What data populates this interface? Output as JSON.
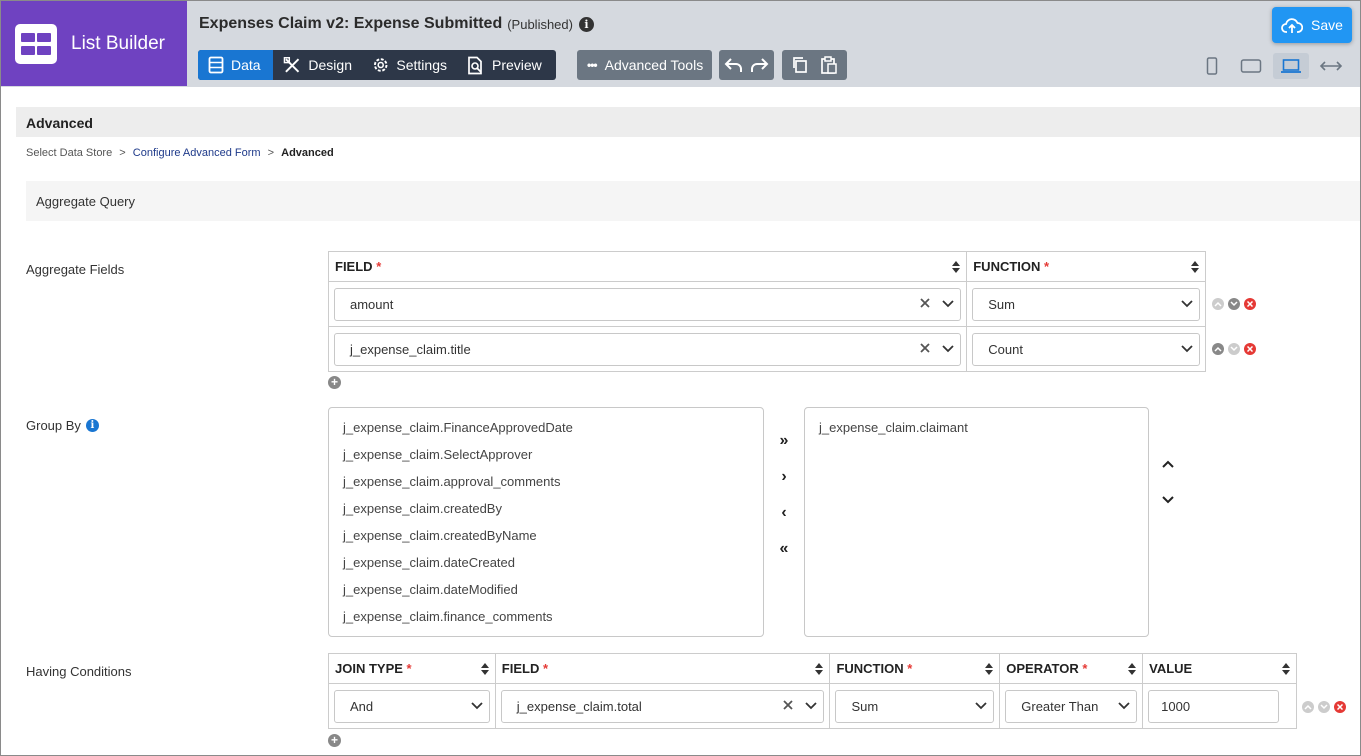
{
  "app": {
    "name": "List Builder"
  },
  "header": {
    "title": "Expenses Claim v2: Expense Submitted",
    "status": "(Published)",
    "info_glyph": "i"
  },
  "tabs": [
    {
      "label": "Data",
      "icon": "data-table-icon",
      "active": true
    },
    {
      "label": "Design",
      "icon": "design-tools-icon",
      "active": false
    },
    {
      "label": "Settings",
      "icon": "gear-icon",
      "active": false
    },
    {
      "label": "Preview",
      "icon": "preview-doc-icon",
      "active": false
    }
  ],
  "toolbar": {
    "advanced_tools_label": "Advanced Tools",
    "save_label": "Save"
  },
  "devices": [
    "mobile-icon",
    "tablet-icon",
    "laptop-icon",
    "fullwidth-icon"
  ],
  "section": {
    "title": "Advanced"
  },
  "breadcrumb": {
    "step1": "Select Data Store",
    "sep": ">",
    "step2": "Configure Advanced Form",
    "step3": "Advanced"
  },
  "panel": {
    "title": "Aggregate Query"
  },
  "aggregate": {
    "label": "Aggregate Fields",
    "headers": {
      "field": "FIELD",
      "function": "FUNCTION",
      "required": "*"
    },
    "rows": [
      {
        "field": "amount",
        "function": "Sum"
      },
      {
        "field": "j_expense_claim.title",
        "function": "Count"
      }
    ]
  },
  "group_by": {
    "label": "Group By",
    "available": [
      "j_expense_claim.FinanceApprovedDate",
      "j_expense_claim.SelectApprover",
      "j_expense_claim.approval_comments",
      "j_expense_claim.createdBy",
      "j_expense_claim.createdByName",
      "j_expense_claim.dateCreated",
      "j_expense_claim.dateModified",
      "j_expense_claim.finance_comments"
    ],
    "selected": [
      "j_expense_claim.claimant"
    ],
    "buttons": {
      "move_all_right": "»",
      "move_right": "›",
      "move_left": "‹",
      "move_all_left": "«"
    }
  },
  "having": {
    "label": "Having Conditions",
    "headers": {
      "join_type": "JOIN TYPE",
      "field": "FIELD",
      "function": "FUNCTION",
      "operator": "OPERATOR",
      "value": "VALUE",
      "required": "*"
    },
    "rows": [
      {
        "join_type": "And",
        "field": "j_expense_claim.total",
        "function": "Sum",
        "operator": "Greater Than",
        "value": "1000"
      }
    ]
  },
  "colors": {
    "brand": "#6f42c1",
    "primary": "#1976d2",
    "save": "#2196f3",
    "danger": "#e53935",
    "topbar": "#d5d9df"
  }
}
